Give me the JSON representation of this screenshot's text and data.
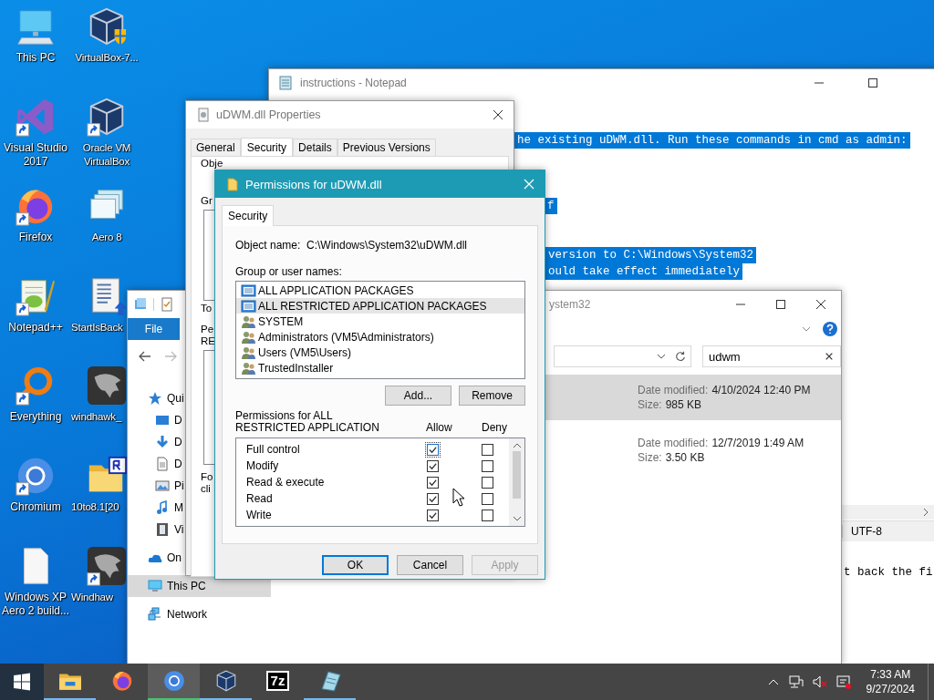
{
  "desktop": {
    "icons": [
      {
        "label": "This PC",
        "kind": "pc",
        "shortcut": false
      },
      {
        "label": "Visual Studio 2017",
        "kind": "vs",
        "shortcut": true
      },
      {
        "label": "Firefox",
        "kind": "firefox",
        "shortcut": true
      },
      {
        "label": "Notepad++",
        "kind": "notepadpp",
        "shortcut": true
      },
      {
        "label": "Everything",
        "kind": "everything",
        "shortcut": true
      },
      {
        "label": "Chromium",
        "kind": "chromium",
        "shortcut": true
      },
      {
        "label": "Windows XP Aero 2 build...",
        "kind": "file",
        "shortcut": false
      },
      {
        "label": "VirtualBox-7...",
        "kind": "vbox_setup",
        "shortcut": false
      },
      {
        "label": "Oracle VM VirtualBox",
        "kind": "vbox",
        "shortcut": true
      },
      {
        "label": "Aero 8",
        "kind": "aero",
        "shortcut": false
      },
      {
        "label": "StartIsBack",
        "kind": "installer",
        "shortcut": false
      },
      {
        "label": "windhawk_",
        "kind": "hawk",
        "shortcut": false
      },
      {
        "label": "10to8.1[20",
        "kind": "folder",
        "shortcut": false
      },
      {
        "label": "Windhaw",
        "kind": "hawk",
        "shortcut": true
      }
    ]
  },
  "notepad": {
    "title": "instructions - Notepad",
    "lines": [
      {
        "text": "he existing uDWM.dll. Run these commands in cmd as admin:",
        "selected": true
      },
      {
        "text": "f",
        "selected": true
      },
      {
        "text": "version to C:\\Windows\\System32",
        "selected": true
      },
      {
        "text": "ould take effect immediately",
        "selected": true
      },
      {
        "text": "t back the fi",
        "selected": false
      }
    ],
    "status": [
      "UTF-8"
    ]
  },
  "explorer": {
    "title": "ystem32",
    "ribbon_tab": "File",
    "search": {
      "value": "udwm"
    },
    "nav": [
      {
        "label": "Qui",
        "kind": "star",
        "selected": false,
        "children": [
          {
            "label": "D",
            "kind": "desktop",
            "selected": false
          },
          {
            "label": "D",
            "kind": "download",
            "selected": false
          },
          {
            "label": "D",
            "kind": "document",
            "selected": false
          },
          {
            "label": "Pi",
            "kind": "picture",
            "selected": false
          },
          {
            "label": "M",
            "kind": "music",
            "selected": false
          },
          {
            "label": "Vi",
            "kind": "video",
            "selected": false
          }
        ]
      },
      {
        "label": "On",
        "kind": "cloud",
        "selected": false
      },
      {
        "label": "This PC",
        "kind": "pc",
        "selected": true
      },
      {
        "label": "Network",
        "kind": "network",
        "selected": false
      }
    ],
    "results": [
      {
        "date_label": "Date modified:",
        "date": "4/10/2024 12:40 PM",
        "size_label": "Size:",
        "size": "985 KB",
        "selected": true
      },
      {
        "date_label": "Date modified:",
        "date": "12/7/2019 1:49 AM",
        "size_label": "Size:",
        "size": "3.50 KB",
        "selected": false
      }
    ]
  },
  "properties": {
    "title": "uDWM.dll Properties",
    "tabs": [
      {
        "label": "General",
        "selected": false
      },
      {
        "label": "Security",
        "selected": true
      },
      {
        "label": "Details",
        "selected": false
      },
      {
        "label": "Previous Versions",
        "selected": false
      }
    ],
    "labels": [
      "Obje",
      "Gr",
      "To",
      "Pe",
      "RE",
      "Fo",
      "cli"
    ]
  },
  "permissions": {
    "title": "Permissions for uDWM.dll",
    "tabs": [
      {
        "label": "Security",
        "selected": true
      }
    ],
    "object_name_label": "Object name:",
    "object_name": "C:\\Windows\\System32\\uDWM.dll",
    "groups_label": "Group or user names:",
    "groups": [
      {
        "name": "ALL APPLICATION PACKAGES",
        "kind": "package",
        "selected": false
      },
      {
        "name": "ALL RESTRICTED APPLICATION PACKAGES",
        "kind": "package",
        "selected": true
      },
      {
        "name": "SYSTEM",
        "kind": "users",
        "selected": false
      },
      {
        "name": "Administrators (VM5\\Administrators)",
        "kind": "users",
        "selected": false
      },
      {
        "name": "Users (VM5\\Users)",
        "kind": "users",
        "selected": false
      },
      {
        "name": "TrustedInstaller",
        "kind": "users",
        "selected": false
      }
    ],
    "group_buttons": [
      "Add...",
      "Remove"
    ],
    "permissions_label": "Permissions for ALL RESTRICTED APPLICATION",
    "columns": [
      "Allow",
      "Deny"
    ],
    "rows": [
      {
        "name": "Full control",
        "allow": true,
        "deny": false,
        "focused": true
      },
      {
        "name": "Modify",
        "allow": true,
        "deny": false,
        "focused": false
      },
      {
        "name": "Read & execute",
        "allow": true,
        "deny": false,
        "focused": false
      },
      {
        "name": "Read",
        "allow": true,
        "deny": false,
        "focused": false
      },
      {
        "name": "Write",
        "allow": true,
        "deny": false,
        "focused": false
      }
    ],
    "buttons": [
      {
        "label": "OK",
        "default": true,
        "disabled": false
      },
      {
        "label": "Cancel",
        "default": false,
        "disabled": false
      },
      {
        "label": "Apply",
        "default": false,
        "disabled": true
      }
    ]
  },
  "taskbar": {
    "apps": [
      {
        "kind": "explorer",
        "running": true,
        "selected": false
      },
      {
        "kind": "firefox",
        "running": false,
        "selected": false
      },
      {
        "kind": "chromium",
        "running": true,
        "selected": true
      },
      {
        "kind": "vbox",
        "running": true,
        "selected": false
      },
      {
        "kind": "sevenzip",
        "label": "7z",
        "running": false,
        "selected": false
      },
      {
        "kind": "notepad",
        "running": true,
        "selected": false
      }
    ],
    "clock": {
      "time": "7:33 AM",
      "date": "9/27/2024"
    }
  }
}
